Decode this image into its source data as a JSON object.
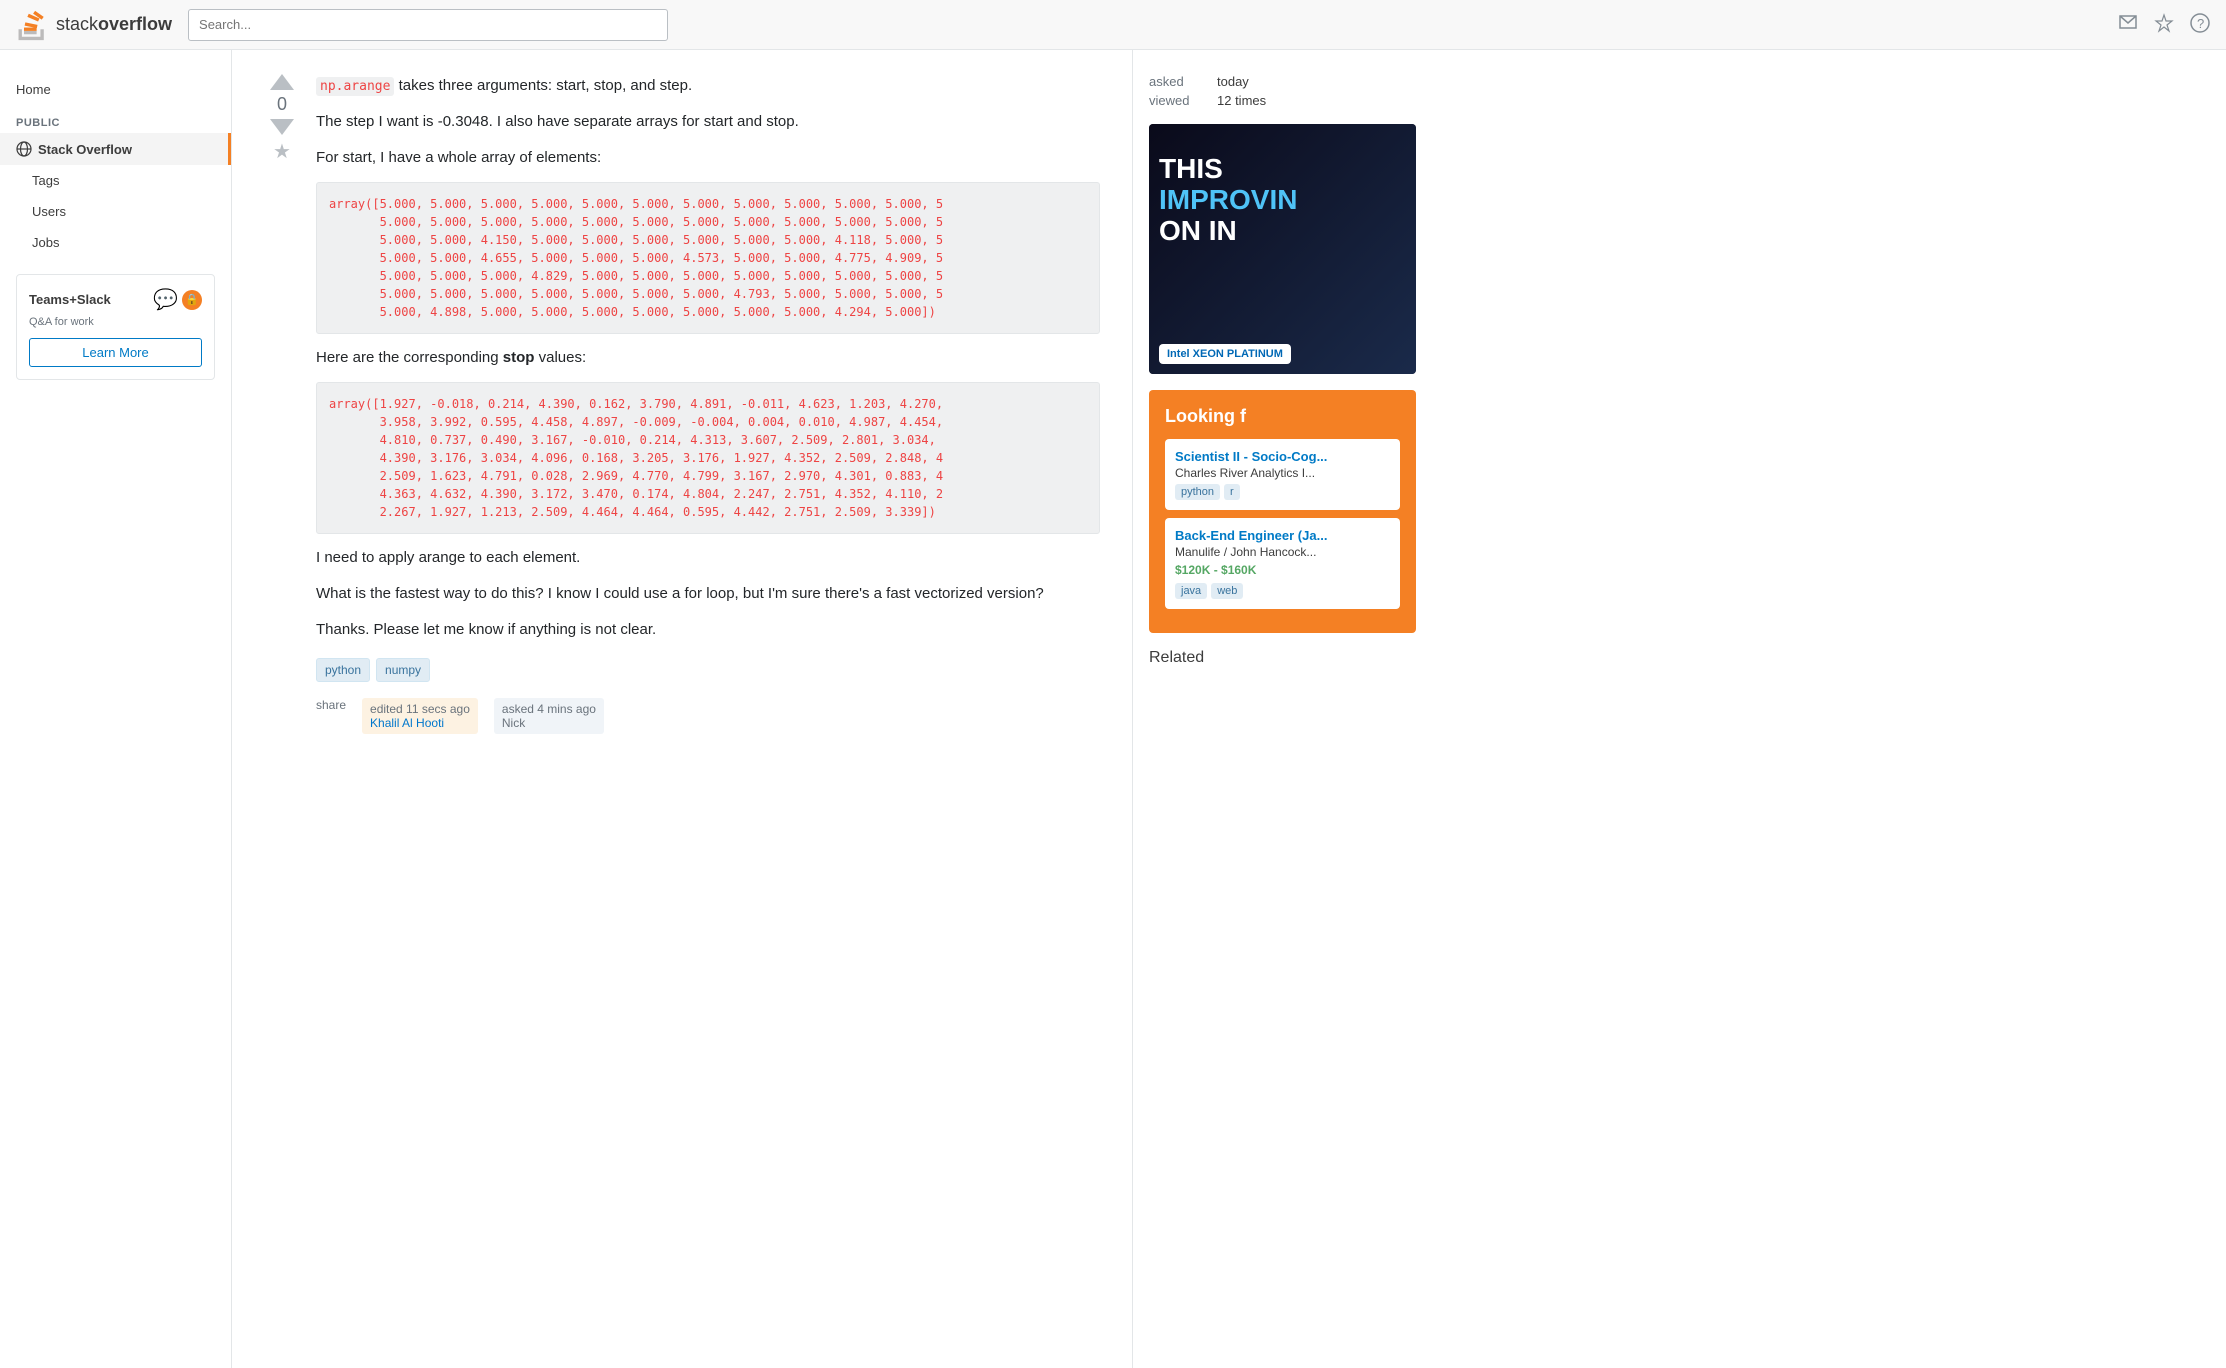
{
  "header": {
    "logo_text_stack": "stack",
    "logo_text_overflow": "overflow",
    "search_placeholder": "Search..."
  },
  "sidebar": {
    "home_label": "Home",
    "section_public": "PUBLIC",
    "stackoverflow_label": "Stack Overflow",
    "tags_label": "Tags",
    "users_label": "Users",
    "jobs_label": "Jobs"
  },
  "teams_box": {
    "title": "Teams+Slack",
    "subtitle": "Q&A for work",
    "learn_more": "Learn More"
  },
  "question": {
    "vote_count": "0",
    "para1": " takes three arguments: start, stop, and step.",
    "inline_code1": "np.arange",
    "para2": "The step I want is -0.3048. I also have separate arrays for start and stop.",
    "para3": "For start, I have a whole array of elements:",
    "code_block1": "array([5.000, 5.000, 5.000, 5.000, 5.000, 5.000, 5.000, 5.000, 5.000, 5.000, 5.000, 5\n       5.000, 5.000, 5.000, 5.000, 5.000, 5.000, 5.000, 5.000, 5.000, 5.000, 5.000, 5\n       5.000, 5.000, 4.150, 5.000, 5.000, 5.000, 5.000, 5.000, 5.000, 4.118, 5.000, 5\n       5.000, 5.000, 4.655, 5.000, 5.000, 5.000, 4.573, 5.000, 5.000, 4.775, 4.909, 5\n       5.000, 5.000, 5.000, 4.829, 5.000, 5.000, 5.000, 5.000, 5.000, 5.000, 5.000, 5\n       5.000, 5.000, 5.000, 5.000, 5.000, 5.000, 5.000, 4.793, 5.000, 5.000, 5.000, 5\n       5.000, 4.898, 5.000, 5.000, 5.000, 5.000, 5.000, 5.000, 5.000, 4.294, 5.000])",
    "para4_pre": "Here are the corresponding ",
    "para4_bold": "stop",
    "para4_post": " values:",
    "code_block2": "array([1.927, -0.018, 0.214, 4.390, 0.162, 3.790, 4.891, -0.011, 4.623, 1.203, 4.270,\n       3.958, 3.992, 0.595, 4.458, 4.897, -0.009, -0.004, 0.004, 0.010, 4.987, 4.454,\n       4.810, 0.737, 0.490, 3.167, -0.010, 0.214, 4.313, 3.607, 2.509, 2.801, 3.034,\n       4.390, 3.176, 3.034, 4.096, 0.168, 3.205, 3.176, 1.927, 4.352, 2.509, 2.848, 4\n       2.509, 1.623, 4.791, 0.028, 2.969, 4.770, 4.799, 3.167, 2.970, 4.301, 0.883, 4\n       4.363, 4.632, 4.390, 3.172, 3.470, 0.174, 4.804, 2.247, 2.751, 4.352, 4.110, 2\n       2.267, 1.927, 1.213, 2.509, 4.464, 4.464, 0.595, 4.442, 2.751, 2.509, 3.339])",
    "para5": "I need to apply arange to each element.",
    "para6": "What is the fastest way to do this? I know I could use a for loop, but I'm sure there's a fast vectorized version?",
    "para7": "Thanks. Please let me know if anything is not clear.",
    "tags": [
      "python",
      "numpy"
    ],
    "share_label": "share",
    "edit_label": "edited 11 secs ago",
    "asked_label": "asked 4 mins ago",
    "user_edit": "Khalil Al Hooti",
    "user_asked": "Nick"
  },
  "right_sidebar": {
    "asked_label": "asked",
    "asked_value": "today",
    "viewed_label": "viewed",
    "viewed_value": "12 times",
    "ad1_text1": "THIS",
    "ad1_text2": "IMPROVIN",
    "ad1_text3": "ON IN",
    "ad1_badge": "Intel XEON PLATINUM",
    "ad2_title": "Looking f",
    "job1_title": "Scientist II - Socio-Cog...",
    "job1_company": "Charles River Analytics I...",
    "job1_tags": [
      "python",
      "r"
    ],
    "job2_title": "Back-End Engineer (Ja...",
    "job2_company": "Manulife / John Hancock...",
    "job2_salary": "$120K - $160K",
    "job2_tags": [
      "java",
      "web"
    ],
    "related_label": "Related"
  }
}
